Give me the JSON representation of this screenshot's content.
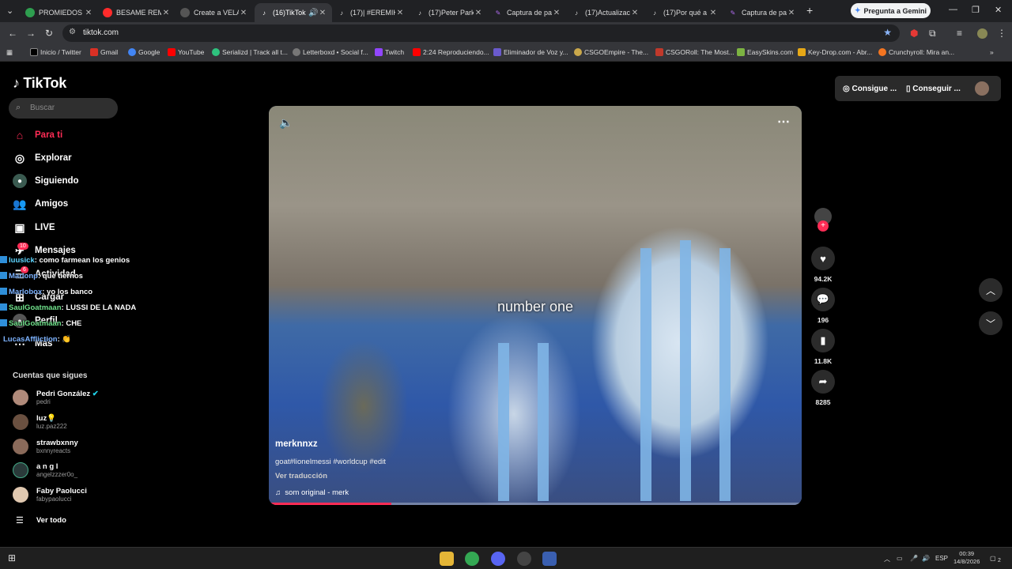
{
  "browser": {
    "tabs": [
      {
        "label": "PROMIEDOS",
        "color": "#2e9e4f"
      },
      {
        "label": "BESAME REMI",
        "color": "#ff2b2b"
      },
      {
        "label": "Create a VELA",
        "color": "#444"
      },
      {
        "label": "(16)TikTok",
        "color": "#111"
      },
      {
        "label": "(17)| #EREMIK",
        "color": "#111"
      },
      {
        "label": "(17)Peter Park",
        "color": "#111"
      },
      {
        "label": "Captura de pa",
        "color": "#8b3bd6"
      },
      {
        "label": "(17)Actualizac",
        "color": "#111"
      },
      {
        "label": "(17)Por qué a",
        "color": "#111"
      },
      {
        "label": "Captura de pa",
        "color": "#8b3bd6"
      }
    ],
    "gemini_label": "Pregunta a Gemini",
    "url": "tiktok.com",
    "bookmarks": [
      {
        "label": "Inicio / Twitter",
        "color": "#000"
      },
      {
        "label": "Gmail",
        "color": "#d93025"
      },
      {
        "label": "Google",
        "color": "#4285f4"
      },
      {
        "label": "YouTube",
        "color": "#ff0000"
      },
      {
        "label": "Serializd | Track all t...",
        "color": "#2ec27e"
      },
      {
        "label": "Letterboxd • Social f...",
        "color": "#777"
      },
      {
        "label": "Twitch",
        "color": "#9146ff"
      },
      {
        "label": "2:24 Reproduciendo...",
        "color": "#ff0000"
      },
      {
        "label": "Eliminador de Voz y...",
        "color": "#6a5acd"
      },
      {
        "label": "CSGOEmpire - The...",
        "color": "#caa84b"
      },
      {
        "label": "CSGORoll: The Most...",
        "color": "#c0392b"
      },
      {
        "label": "EasySkins.com",
        "color": "#7cb342"
      },
      {
        "label": "Key-Drop.com - Abr...",
        "color": "#e6a817"
      },
      {
        "label": "Crunchyroll: Mira an...",
        "color": "#f47521"
      }
    ]
  },
  "sidebar": {
    "logo": "TikTok",
    "search_placeholder": "Buscar",
    "nav": [
      {
        "label": "Para ti",
        "icon": "home-icon"
      },
      {
        "label": "Explorar",
        "icon": "compass-icon"
      },
      {
        "label": "Siguiendo",
        "icon": "following-icon"
      },
      {
        "label": "Amigos",
        "icon": "friends-icon"
      },
      {
        "label": "LIVE",
        "icon": "live-icon"
      },
      {
        "label": "Mensajes",
        "icon": "messages-icon"
      },
      {
        "label": "Actividad",
        "icon": "activity-icon"
      },
      {
        "label": "Cargar",
        "icon": "upload-icon"
      },
      {
        "label": "Perfil",
        "icon": "profile-icon"
      },
      {
        "label": "Más",
        "icon": "more-icon"
      }
    ],
    "messages_badge": "10",
    "activity_badge": "6",
    "following_header": "Cuentas que sigues",
    "accounts": [
      {
        "name": "Pedri González",
        "handle": "pedri",
        "verified": true
      },
      {
        "name": "luz💡",
        "handle": "luz.paz222"
      },
      {
        "name": "strawbxnny",
        "handle": "bxnnyreacts"
      },
      {
        "name": "a n g l",
        "handle": "angelzzzer0o_"
      },
      {
        "name": "Faby Paolucci",
        "handle": "fabypaolucci"
      }
    ],
    "see_all": "Ver todo"
  },
  "chat": [
    {
      "user": "luusick",
      "msg": ": como farmean los genios"
    },
    {
      "user": "Marlonp",
      "msg": ": que tiernos"
    },
    {
      "user": "Marlobox",
      "msg": ": yo los banco"
    },
    {
      "user": "SaulGoatmaan",
      "msg": ": LUSSI DE LA NADA"
    },
    {
      "user": "SaulGoatmaan",
      "msg": ": CHE"
    },
    {
      "user": "LucasAffliction",
      "msg": ": 👏"
    }
  ],
  "video": {
    "caption": "number one",
    "username": "merknnxz",
    "description": "goat#lionelmessi #worldcup #edit",
    "translate": "Ver traducción",
    "sound": "som original - merk",
    "progress_percent": 23
  },
  "actions": {
    "likes": "94.2K",
    "comments": "196",
    "saves": "11.8K",
    "shares": "8285"
  },
  "topbar": {
    "coins": "Consigue ...",
    "app": "Conseguir ..."
  },
  "taskbar": {
    "lang": "ESP",
    "time": "00:39",
    "date": "14/8/2026",
    "notif": "2"
  }
}
